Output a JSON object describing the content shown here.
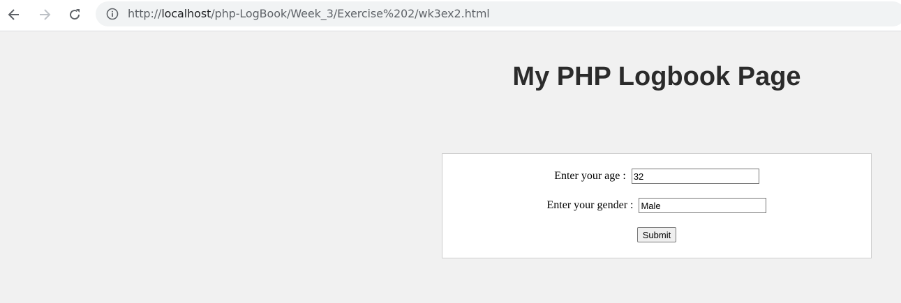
{
  "browser": {
    "url_scheme": "http://",
    "url_host": "localhost",
    "url_path": "/php-LogBook/Week_3/Exercise%202/wk3ex2.html"
  },
  "page": {
    "title": "My PHP Logbook Page"
  },
  "form": {
    "age_label": "Enter your age :",
    "age_value": "32",
    "gender_label": "Enter your gender :",
    "gender_value": "Male",
    "submit_label": "Submit"
  }
}
